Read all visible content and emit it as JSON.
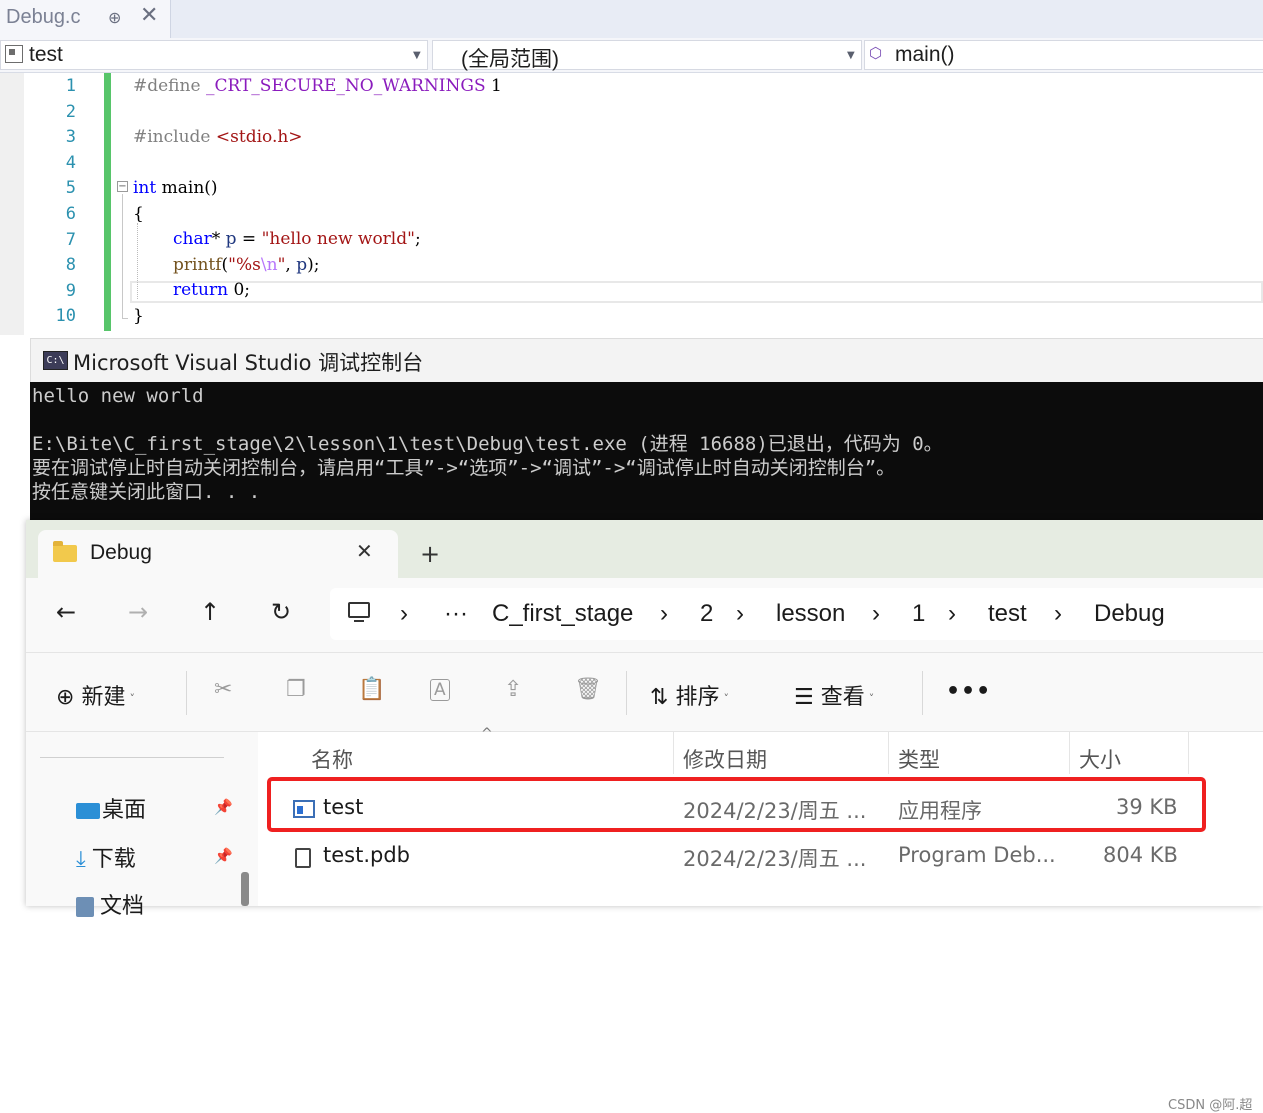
{
  "vs": {
    "tab_name": "Debug.c",
    "pin_glyph": "⊕",
    "close_glyph": "✕",
    "nav": {
      "project": "test",
      "scope": "(全局范围)",
      "member": "main()"
    },
    "line_numbers": [
      "1",
      "2",
      "3",
      "4",
      "5",
      "6",
      "7",
      "8",
      "9",
      "10"
    ],
    "code": {
      "l1_directive": "#define ",
      "l1_macro": "_CRT_SECURE_NO_WARNINGS",
      "l1_value": " 1",
      "l3_directive": "#include ",
      "l3_header": "<stdio.h>",
      "l5_kw": "int",
      "l5_rest": " main()",
      "l6": "{",
      "l7_kw": "char",
      "l7_rest_a": "* ",
      "l7_id": "p",
      "l7_eq": " = ",
      "l7_str": "\"hello new world\"",
      "l7_end": ";",
      "l8_fn": "printf",
      "l8_open": "(",
      "l8_str_a": "\"%s",
      "l8_esc": "\\n",
      "l8_str_b": "\"",
      "l8_comma": ", ",
      "l8_id": "p",
      "l8_end": ");",
      "l9_kw": "return",
      "l9_rest": " 0;",
      "l10": "}"
    }
  },
  "console": {
    "icon_text": "C:\\",
    "title": "Microsoft Visual Studio 调试控制台",
    "lines": [
      "hello new world",
      "",
      "E:\\Bite\\C_first_stage\\2\\lesson\\1\\test\\Debug\\test.exe (进程 16688)已退出，代码为 0。",
      "要在调试停止时自动关闭控制台，请启用“工具”->“选项”->“调试”->“调试停止时自动关闭控制台”。",
      "按任意键关闭此窗口. . ."
    ]
  },
  "explorer": {
    "tab_title": "Debug",
    "close_glyph": "✕",
    "newtab_glyph": "+",
    "nav": {
      "back": "←",
      "forward": "→",
      "up": "↑",
      "refresh": "↻"
    },
    "breadcrumb": {
      "sep": "›",
      "ellipsis": "···",
      "items": [
        "C_first_stage",
        "2",
        "lesson",
        "1",
        "test",
        "Debug"
      ]
    },
    "toolbar": {
      "new_label": "新建",
      "new_glyph": "⊕",
      "cut_glyph": "✂",
      "copy_glyph": "❐",
      "paste_glyph": "📋",
      "rename_glyph": "A",
      "share_glyph": "⇪",
      "delete_glyph": "🗑",
      "sort_label": "排序",
      "sort_glyph": "⇅",
      "view_label": "查看",
      "view_glyph": "☰",
      "more_glyph": "•••"
    },
    "sidebar": [
      {
        "label": "桌面",
        "icon": "desktop-icon"
      },
      {
        "label": "下载",
        "icon": "download-icon"
      },
      {
        "label": "文档",
        "icon": "documents-icon"
      }
    ],
    "sidebar_pin_glyph": "📌",
    "columns": {
      "name": "名称",
      "modified": "修改日期",
      "type": "类型",
      "size": "大小"
    },
    "sort_arrow": "^",
    "files": [
      {
        "name": "test",
        "modified": "2024/2/23/周五 ...",
        "type": "应用程序",
        "size": "39 KB"
      },
      {
        "name": "test.pdb",
        "modified": "2024/2/23/周五 ...",
        "type": "Program Deb...",
        "size": "804 KB"
      }
    ],
    "highlight_color": "#ef2020",
    "watermark": "CSDN @阿.超"
  }
}
